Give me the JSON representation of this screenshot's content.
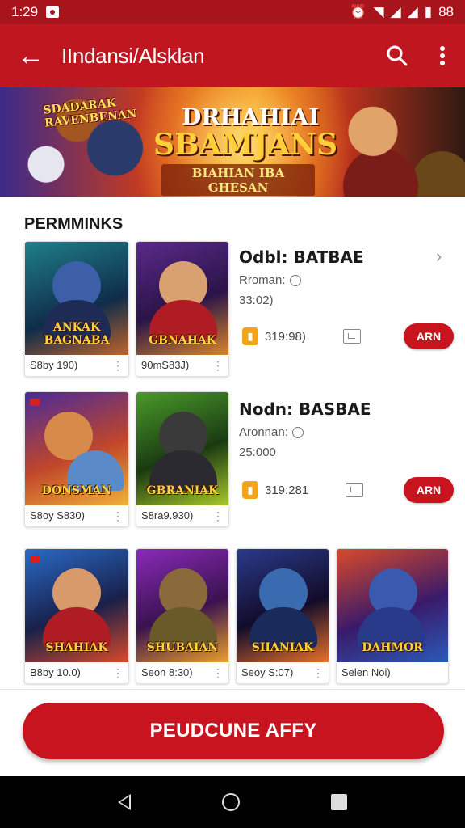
{
  "status_bar": {
    "time": "1:29",
    "battery": "88"
  },
  "app_bar": {
    "title": "IIndansi/Alsklan"
  },
  "banner": {
    "tag_left": "SDADARAK RAVENBENAN",
    "headline_line1": "DRHAHIAI",
    "headline_line2": "SBAMJANS",
    "headline_line3": "BIAHIAN IBA GHESAN"
  },
  "section": {
    "title": "PERMMINKS"
  },
  "rows": [
    {
      "cards": [
        {
          "art_text": "ANKAK BAGNABA",
          "caption": "S8by 190)"
        },
        {
          "art_text": "GBNAHAK",
          "caption": "90mS83J)"
        }
      ],
      "info": {
        "name": "Odbl: BATBAE",
        "sub": "Rroman:",
        "sub2": "33:02)",
        "price": "319:98)",
        "buy_label": "ARN"
      }
    },
    {
      "cards": [
        {
          "art_text": "DONSMAN",
          "caption": "S8oy S830)"
        },
        {
          "art_text": "GBRANIAK",
          "caption": "S8ra9.930)"
        }
      ],
      "info": {
        "name": "Nodn: BASBAE",
        "sub": "Aronnan:",
        "sub2": "25:000",
        "price": "319:281",
        "buy_label": "ARN"
      }
    },
    {
      "cards": [
        {
          "art_text": "SHAHIAK",
          "caption": "B8by 10.0)"
        },
        {
          "art_text": "SHUBAIAN",
          "caption": "Seon 8:30)"
        },
        {
          "art_text": "SIIANIAK",
          "caption": "Seoy S:07)"
        },
        {
          "art_text": "DAHMOR",
          "caption": "Selen Noi)"
        }
      ]
    }
  ],
  "primary_button": {
    "label": "PEUDCUNE AFFY"
  },
  "colors": {
    "app_bar": "#c0161f",
    "status_bar": "#a8141c",
    "accent": "#c8141e",
    "coin": "#f2a51a"
  }
}
